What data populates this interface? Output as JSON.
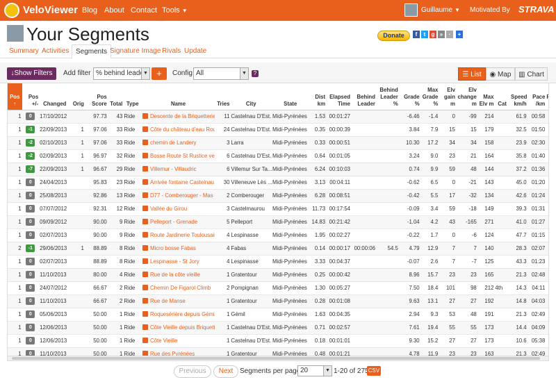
{
  "nav": {
    "brand": "VeloViewer",
    "links": [
      "Blog",
      "About",
      "Contact",
      "Tools"
    ],
    "user": "Guillaume",
    "motivated": "Motivated By",
    "strava": "STRAVA"
  },
  "page": {
    "title": "Your Segments",
    "donate": "Donate"
  },
  "tabs": [
    "Summary",
    "Activities",
    "Segments",
    "Signature Image",
    "Rivals",
    "Update"
  ],
  "toolbar": {
    "show_filters": "Show Filters",
    "add_filter_label": "Add filter",
    "add_filter_value": "% behind leader",
    "config_label": "Config",
    "config_value": "All",
    "views": [
      "List",
      "Map",
      "Chart"
    ]
  },
  "columns": [
    "Pos ↑",
    "Pos +/-",
    "Changed",
    "Orig",
    "Pos Score",
    "Total",
    "Type",
    "Name",
    "Tries",
    "City",
    "State",
    "Dist km",
    "Elapsed Time",
    "Behind Leader",
    "Behind Leader %",
    "Grade %",
    "Max Grade %",
    "Elv gain m",
    "Elv change m",
    "Max Elv m",
    "Cat",
    "Speed km/h",
    "Pace /km",
    "Pace /1"
  ],
  "rows": [
    {
      "pos": "1",
      "delta": "0",
      "dir": "same",
      "changed": "17/10/2012",
      "orig": "",
      "score": "97.73",
      "total": "43",
      "type": "Ride",
      "name": "Descente de la Briquetterie",
      "tries": "11",
      "city": "Castelnau D'Est...",
      "state": "Midi-Pyrénées",
      "dist": "1.53",
      "time": "00:01:27",
      "behind": "",
      "behind_pct": "",
      "grade": "-6.46",
      "maxgrade": "-1.4",
      "elvgain": "0",
      "elvchange": "-99",
      "maxelv": "214",
      "cat": "",
      "speed": "61.9",
      "pace": "00:58",
      "pace1": "01"
    },
    {
      "pos": "1",
      "delta": "-1",
      "dir": "up",
      "changed": "22/09/2013",
      "orig": "1",
      "score": "97.06",
      "total": "33",
      "type": "Ride",
      "name": "Côte du château d'eau Rouffiac",
      "tries": "24",
      "city": "Castelnau D'Est...",
      "state": "Midi-Pyrénées",
      "dist": "0.35",
      "time": "00:00:39",
      "behind": "",
      "behind_pct": "",
      "grade": "3.84",
      "maxgrade": "7.9",
      "elvgain": "15",
      "elvchange": "15",
      "maxelv": "179",
      "cat": "",
      "speed": "32.5",
      "pace": "01:50",
      "pace1": "02"
    },
    {
      "pos": "1",
      "delta": "-2",
      "dir": "up",
      "changed": "02/10/2013",
      "orig": "1",
      "score": "97.06",
      "total": "33",
      "type": "Ride",
      "name": "chemin de Landery",
      "tries": "3",
      "city": "Larra",
      "state": "Midi-Pyrénées",
      "dist": "0.33",
      "time": "00:00:51",
      "behind": "",
      "behind_pct": "",
      "grade": "10.30",
      "maxgrade": "17.2",
      "elvgain": "34",
      "elvchange": "34",
      "maxelv": "158",
      "cat": "",
      "speed": "23.9",
      "pace": "02:30",
      "pace1": "04"
    },
    {
      "pos": "1",
      "delta": "-2",
      "dir": "up",
      "changed": "02/09/2013",
      "orig": "1",
      "score": "96.97",
      "total": "32",
      "type": "Ride",
      "name": "Bosse Route St Rustice vers",
      "tries": "6",
      "city": "Castelnau D'Est...",
      "state": "Midi-Pyrénées",
      "dist": "0.64",
      "time": "00:01:05",
      "behind": "",
      "behind_pct": "",
      "grade": "3.24",
      "maxgrade": "9.0",
      "elvgain": "23",
      "elvchange": "21",
      "maxelv": "164",
      "cat": "",
      "speed": "35.8",
      "pace": "01:40",
      "pace1": "02"
    },
    {
      "pos": "1",
      "delta": "-7",
      "dir": "up",
      "changed": "22/09/2013",
      "orig": "1",
      "score": "96.67",
      "total": "29",
      "type": "Ride",
      "name": "Villemur - Villaudric",
      "tries": "6",
      "city": "Villemur Sur Ta...",
      "state": "Midi-Pyrénées",
      "dist": "6.24",
      "time": "00:10:03",
      "behind": "",
      "behind_pct": "",
      "grade": "0.74",
      "maxgrade": "9.9",
      "elvgain": "59",
      "elvchange": "48",
      "maxelv": "144",
      "cat": "",
      "speed": "37.2",
      "pace": "01:36",
      "pace1": "02"
    },
    {
      "pos": "1",
      "delta": "0",
      "dir": "same",
      "changed": "24/04/2013",
      "orig": "",
      "score": "95.83",
      "total": "23",
      "type": "Ride",
      "name": "Arrivée fontaine Castelnau",
      "tries": "30",
      "city": "Villeneuve Lès ...",
      "state": "Midi-Pyrénées",
      "dist": "3.13",
      "time": "00:04:11",
      "behind": "",
      "behind_pct": "",
      "grade": "-0.62",
      "maxgrade": "6.5",
      "elvgain": "0",
      "elvchange": "-21",
      "maxelv": "143",
      "cat": "",
      "speed": "45.0",
      "pace": "01:20",
      "pace1": "02"
    },
    {
      "pos": "1",
      "delta": "0",
      "dir": "same",
      "changed": "25/08/2013",
      "orig": "",
      "score": "92.86",
      "total": "13",
      "type": "Ride",
      "name": "D77 - Comberouger - Mas",
      "tries": "2",
      "city": "Comberouger",
      "state": "Midi-Pyrénées",
      "dist": "6.28",
      "time": "00:08:51",
      "behind": "",
      "behind_pct": "",
      "grade": "-0.42",
      "maxgrade": "5.5",
      "elvgain": "17",
      "elvchange": "-32",
      "maxelv": "134",
      "cat": "",
      "speed": "42.6",
      "pace": "01:24",
      "pace1": "02"
    },
    {
      "pos": "1",
      "delta": "0",
      "dir": "same",
      "changed": "07/07/2012",
      "orig": "",
      "score": "92.31",
      "total": "12",
      "type": "Ride",
      "name": "Vallée du Girou",
      "tries": "3",
      "city": "Castelmaurou",
      "state": "Midi-Pyrénées",
      "dist": "11.73",
      "time": "00:17:54",
      "behind": "",
      "behind_pct": "",
      "grade": "-0.09",
      "maxgrade": "3.4",
      "elvgain": "59",
      "elvchange": "-18",
      "maxelv": "149",
      "cat": "",
      "speed": "39.3",
      "pace": "01:31",
      "pace1": "02"
    },
    {
      "pos": "1",
      "delta": "0",
      "dir": "same",
      "changed": "09/09/2012",
      "orig": "",
      "score": "90.00",
      "total": "9",
      "type": "Ride",
      "name": "Pelleport - Grenade",
      "tries": "5",
      "city": "Pelleport",
      "state": "Midi-Pyrénées",
      "dist": "14.83",
      "time": "00:21:42",
      "behind": "",
      "behind_pct": "",
      "grade": "-1.04",
      "maxgrade": "4.2",
      "elvgain": "43",
      "elvchange": "-165",
      "maxelv": "271",
      "cat": "",
      "speed": "41.0",
      "pace": "01:27",
      "pace1": "02"
    },
    {
      "pos": "1",
      "delta": "0",
      "dir": "same",
      "changed": "02/07/2013",
      "orig": "",
      "score": "90.00",
      "total": "9",
      "type": "Ride",
      "name": "Route Jardinerie Toulousaine",
      "tries": "4",
      "city": "Lespinasse",
      "state": "Midi-Pyrénées",
      "dist": "1.95",
      "time": "00:02:27",
      "behind": "",
      "behind_pct": "",
      "grade": "-0.22",
      "maxgrade": "1.7",
      "elvgain": "0",
      "elvchange": "-6",
      "maxelv": "124",
      "cat": "",
      "speed": "47.7",
      "pace": "01:15",
      "pace1": "02"
    },
    {
      "pos": "2",
      "delta": "-1",
      "dir": "up",
      "changed": "29/06/2013",
      "orig": "1",
      "score": "88.89",
      "total": "8",
      "type": "Ride",
      "name": "Micro bosse Fabas",
      "tries": "4",
      "city": "Fabas",
      "state": "Midi-Pyrénées",
      "dist": "0.14",
      "time": "00:00:17",
      "behind": "00:00:06",
      "behind_pct": "54.5",
      "grade": "4.79",
      "maxgrade": "12.9",
      "elvgain": "7",
      "elvchange": "7",
      "maxelv": "140",
      "cat": "",
      "speed": "28.3",
      "pace": "02:07",
      "pace1": "03"
    },
    {
      "pos": "1",
      "delta": "0",
      "dir": "same",
      "changed": "02/07/2013",
      "orig": "",
      "score": "88.89",
      "total": "8",
      "type": "Ride",
      "name": "Lespinasse - St Jory",
      "tries": "4",
      "city": "Lespinasse",
      "state": "Midi-Pyrénées",
      "dist": "3.33",
      "time": "00:04:37",
      "behind": "",
      "behind_pct": "",
      "grade": "-0.07",
      "maxgrade": "2.6",
      "elvgain": "7",
      "elvchange": "-7",
      "maxelv": "125",
      "cat": "",
      "speed": "43.3",
      "pace": "01:23",
      "pace1": "02"
    },
    {
      "pos": "1",
      "delta": "0",
      "dir": "same",
      "changed": "11/10/2013",
      "orig": "",
      "score": "80.00",
      "total": "4",
      "type": "Ride",
      "name": "Rue de la côte vieille",
      "tries": "1",
      "city": "Gratentour",
      "state": "Midi-Pyrénées",
      "dist": "0.25",
      "time": "00:00:42",
      "behind": "",
      "behind_pct": "",
      "grade": "8.96",
      "maxgrade": "15.7",
      "elvgain": "23",
      "elvchange": "23",
      "maxelv": "165",
      "cat": "",
      "speed": "21.3",
      "pace": "02:48",
      "pace1": "04"
    },
    {
      "pos": "1",
      "delta": "0",
      "dir": "same",
      "changed": "24/07/2012",
      "orig": "",
      "score": "66.67",
      "total": "2",
      "type": "Ride",
      "name": "Chemin De Figarol Climb",
      "tries": "2",
      "city": "Pompignan",
      "state": "Midi-Pyrénées",
      "dist": "1.30",
      "time": "00:05:27",
      "behind": "",
      "behind_pct": "",
      "grade": "7.50",
      "maxgrade": "18.4",
      "elvgain": "101",
      "elvchange": "98",
      "maxelv": "212",
      "cat": "4th",
      "speed": "14.3",
      "pace": "04:11",
      "pace1": "06"
    },
    {
      "pos": "1",
      "delta": "0",
      "dir": "same",
      "changed": "11/10/2013",
      "orig": "",
      "score": "66.67",
      "total": "2",
      "type": "Ride",
      "name": "Rue de Manse",
      "tries": "1",
      "city": "Gratentour",
      "state": "Midi-Pyrénées",
      "dist": "0.28",
      "time": "00:01:08",
      "behind": "",
      "behind_pct": "",
      "grade": "9.63",
      "maxgrade": "13.1",
      "elvgain": "27",
      "elvchange": "27",
      "maxelv": "192",
      "cat": "",
      "speed": "14.8",
      "pace": "04:03",
      "pace1": "06"
    },
    {
      "pos": "1",
      "delta": "0",
      "dir": "same",
      "changed": "05/06/2013",
      "orig": "",
      "score": "50.00",
      "total": "1",
      "type": "Ride",
      "name": "Roquesérière depuis Gémil",
      "tries": "1",
      "city": "Gémil",
      "state": "Midi-Pyrénées",
      "dist": "1.63",
      "time": "00:04:35",
      "behind": "",
      "behind_pct": "",
      "grade": "2.94",
      "maxgrade": "9.3",
      "elvgain": "53",
      "elvchange": "48",
      "maxelv": "191",
      "cat": "",
      "speed": "21.3",
      "pace": "02:49",
      "pace1": "04"
    },
    {
      "pos": "1",
      "delta": "0",
      "dir": "same",
      "changed": "12/06/2013",
      "orig": "",
      "score": "50.00",
      "total": "1",
      "type": "Ride",
      "name": "Côte Vieille depuis Briquetterie",
      "tries": "1",
      "city": "Castelnau D'Est...",
      "state": "Midi-Pyrénées",
      "dist": "0.71",
      "time": "00:02:57",
      "behind": "",
      "behind_pct": "",
      "grade": "7.61",
      "maxgrade": "19.4",
      "elvgain": "55",
      "elvchange": "55",
      "maxelv": "173",
      "cat": "",
      "speed": "14.4",
      "pace": "04:09",
      "pace1": "06"
    },
    {
      "pos": "1",
      "delta": "0",
      "dir": "same",
      "changed": "12/06/2013",
      "orig": "",
      "score": "50.00",
      "total": "1",
      "type": "Ride",
      "name": "Côte Vieille",
      "tries": "1",
      "city": "Castelnau D'Est...",
      "state": "Midi-Pyrénées",
      "dist": "0.18",
      "time": "00:01:01",
      "behind": "",
      "behind_pct": "",
      "grade": "9.30",
      "maxgrade": "15.2",
      "elvgain": "27",
      "elvchange": "27",
      "maxelv": "173",
      "cat": "",
      "speed": "10.6",
      "pace": "05:38",
      "pace1": "09"
    },
    {
      "pos": "1",
      "delta": "0",
      "dir": "same",
      "changed": "11/10/2013",
      "orig": "",
      "score": "50.00",
      "total": "1",
      "type": "Ride",
      "name": "Rue des Pyrénées",
      "tries": "1",
      "city": "Gratentour",
      "state": "Midi-Pyrénées",
      "dist": "0.48",
      "time": "00:01:21",
      "behind": "",
      "behind_pct": "",
      "grade": "4.78",
      "maxgrade": "11.9",
      "elvgain": "23",
      "elvchange": "23",
      "maxelv": "163",
      "cat": "",
      "speed": "21.3",
      "pace": "02:49",
      "pace1": "04"
    },
    {
      "pos": "2",
      "delta": "-1",
      "dir": "up",
      "changed": "11/10/2013",
      "orig": "2",
      "score": "96.30",
      "total": "54",
      "type": "Ride",
      "name": "Ondes - Castelnau",
      "tries": "9",
      "city": "Ondes",
      "state": "Midi-Pyrénées",
      "dist": "1.69",
      "time": "00:02:07",
      "behind": "00:00:13",
      "behind_pct": "11.4",
      "grade": "0.08",
      "maxgrade": "4.0",
      "elvgain": "9",
      "elvchange": "6",
      "maxelv": "174",
      "cat": "",
      "speed": "47.9",
      "pace": "01:15",
      "pace1": "02"
    }
  ],
  "pager": {
    "previous": "Previous",
    "next": "Next",
    "per_page_label": "Segments per page:",
    "per_page_value": "20",
    "range": "1-20 of 275",
    "csv": "CSV"
  },
  "colors": {
    "brand": "#e8601c",
    "purple": "#6a2c5e",
    "up": "#3c9b3c"
  }
}
